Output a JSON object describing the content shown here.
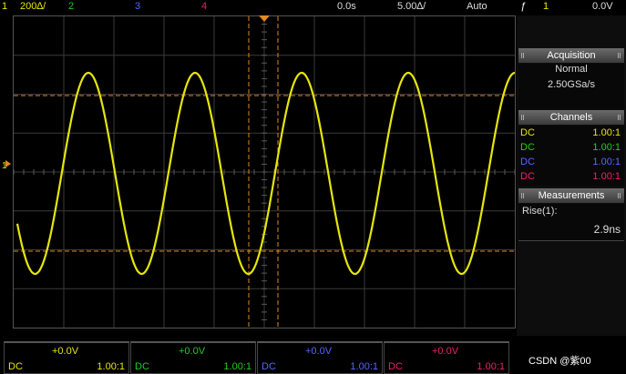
{
  "topbar": {
    "ch1_num": "1",
    "ch1_scale": "200∆/",
    "ch2_num": "2",
    "ch3_num": "3",
    "ch4_num": "4",
    "delay": "0.0s",
    "timebase": "5.00∆/",
    "trigger_mode": "Auto",
    "trigger_icon": "ƒ",
    "trigger_channel": "1",
    "trigger_level": "0.0V"
  },
  "acquisition": {
    "title": "Acquisition",
    "mode": "Normal",
    "rate": "2.50GSa/s"
  },
  "channels": {
    "title": "Channels",
    "items": [
      {
        "coupling": "DC",
        "probe": "1.00:1",
        "color": "#e6e60a"
      },
      {
        "coupling": "DC",
        "probe": "1.00:1",
        "color": "#22cc22"
      },
      {
        "coupling": "DC",
        "probe": "1.00:1",
        "color": "#5566ff"
      },
      {
        "coupling": "DC",
        "probe": "1.00:1",
        "color": "#ee2266"
      }
    ]
  },
  "measurements": {
    "title": "Measurements",
    "label": "Rise(1):",
    "value": "2.9ns"
  },
  "bottom": [
    {
      "offset": "+0.0V",
      "coupling": "DC",
      "probe": "1.00:1",
      "color": "#e6e60a"
    },
    {
      "offset": "+0.0V",
      "coupling": "DC",
      "probe": "1.00:1",
      "color": "#22cc22"
    },
    {
      "offset": "+0.0V",
      "coupling": "DC",
      "probe": "1.00:1",
      "color": "#5566ff"
    },
    {
      "offset": "+0.0V",
      "coupling": "DC",
      "probe": "1.00:1",
      "color": "#ee2266"
    }
  ],
  "watermark": "CSDN @紫00",
  "colors": {
    "ch1": "#e6e60a",
    "ch2": "#22cc22",
    "ch3": "#5566ff",
    "ch4": "#ee2266",
    "cursor": "#e08a1e"
  },
  "waveform": {
    "cycles_shown": 4.7,
    "shape": "sine"
  }
}
